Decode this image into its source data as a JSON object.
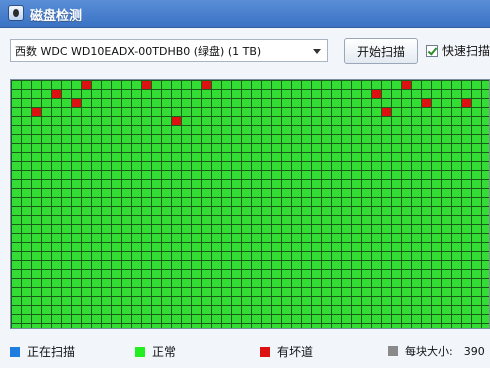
{
  "window": {
    "title": "磁盘检测",
    "app_icon": "disk-check-icon"
  },
  "toolbar": {
    "disk_select_value": "西数 WDC WD10EADX-00TDHB0 (绿盘) (1 TB)",
    "scan_button_label": "开始扫描",
    "quick_scan_label": "快速扫描",
    "quick_scan_checked": true
  },
  "grid": {
    "columns": 48,
    "rows": 28,
    "colors": {
      "normal": "#33dd33",
      "bad": "#dd1111",
      "scanning": "#1e7de0",
      "border": "#1a5a1a"
    },
    "bad_blocks": [
      {
        "col": 7,
        "row": 0
      },
      {
        "col": 13,
        "row": 0
      },
      {
        "col": 19,
        "row": 0
      },
      {
        "col": 39,
        "row": 0
      },
      {
        "col": 4,
        "row": 1
      },
      {
        "col": 36,
        "row": 1
      },
      {
        "col": 6,
        "row": 2
      },
      {
        "col": 41,
        "row": 2
      },
      {
        "col": 45,
        "row": 2
      },
      {
        "col": 2,
        "row": 3
      },
      {
        "col": 37,
        "row": 3
      },
      {
        "col": 16,
        "row": 4
      }
    ]
  },
  "legend": {
    "scanning": {
      "label": "正在扫描",
      "color": "#1e7de0"
    },
    "normal": {
      "label": "正常",
      "color": "#22ee22"
    },
    "bad": {
      "label": "有坏道",
      "color": "#dd1111"
    },
    "per_block": {
      "label": "每块大小:",
      "color": "#8a8a8a",
      "value": "390"
    }
  }
}
